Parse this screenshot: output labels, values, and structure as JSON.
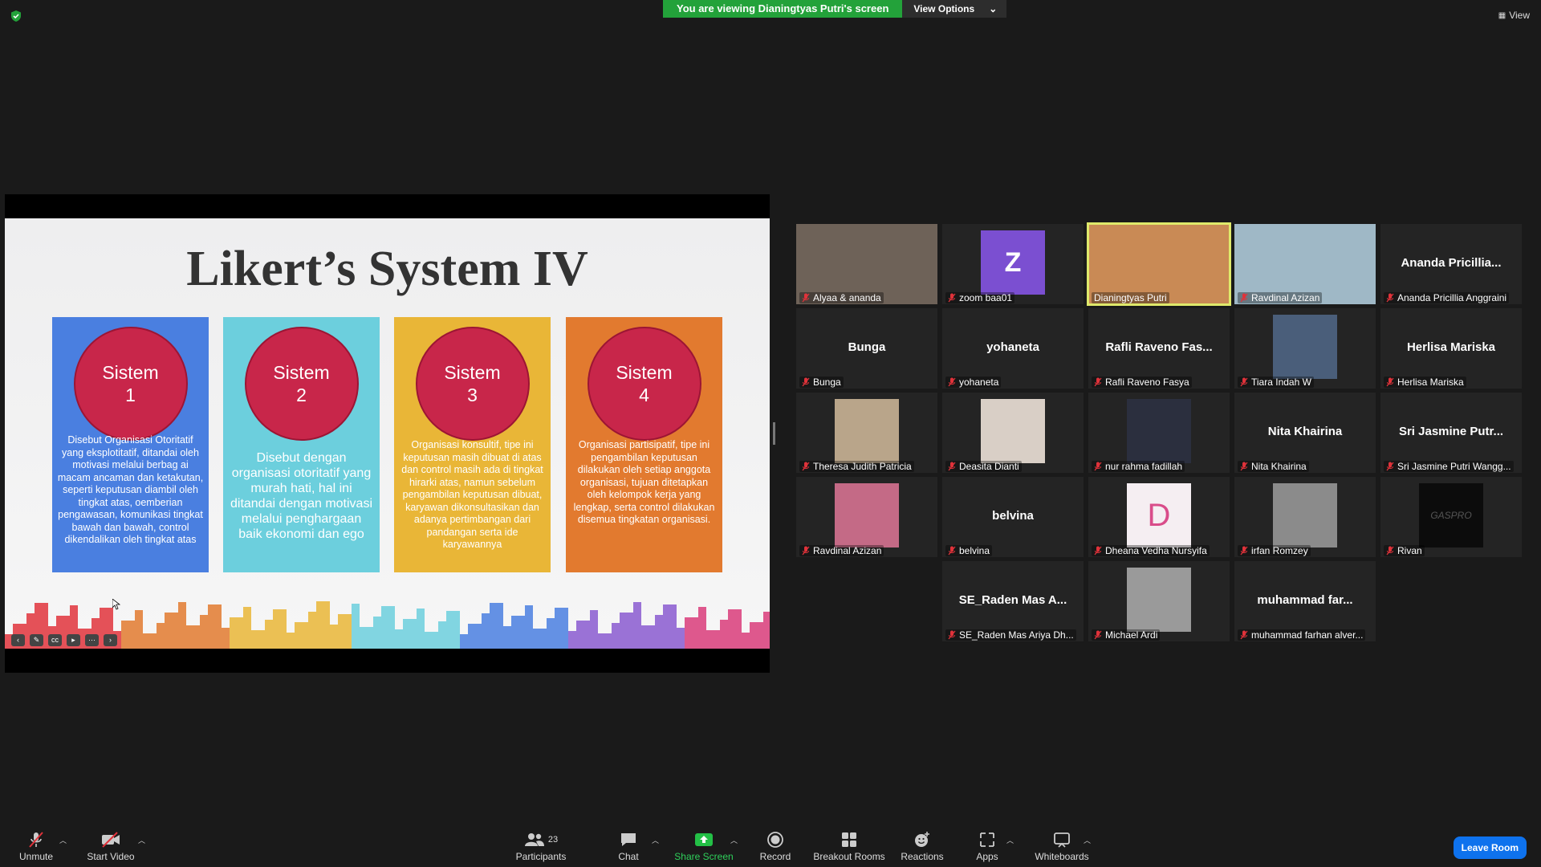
{
  "top": {
    "banner_message": "You are viewing Dianingtyas Putri's screen",
    "view_options_label": "View Options",
    "view_label": "View"
  },
  "slide": {
    "title": "Likert’s System IV",
    "cards": [
      {
        "circle": "Sistem\n1",
        "color": "#4a7fe0",
        "desc": "Disebut Organisasi Otoritatif yang eksplotitatif,   ditandai oleh motivasi melalui berbag ai macam ancaman dan ketakutan, seperti keputusan diambil oleh tingkat atas, oemberian pengawasan, komunikasi tingkat bawah dan bawah, control dikendalikan oleh tingkat atas"
      },
      {
        "circle": "Sistem\n2",
        "color": "#6ccfdd",
        "desc": "Disebut dengan organisasi otoritatif yang murah hati, hal ini ditandai dengan motivasi melalui penghargaan baik ekonomi dan ego"
      },
      {
        "circle": "Sistem\n3",
        "color": "#e9b637",
        "desc": "Organisasi konsultif, tipe ini keputusan masih dibuat di atas dan control masih ada di tingkat hirarki atas, namun sebelum pengambilan keputusan dibuat, karyawan dikonsultasikan  dan adanya pertimbangan dari pandangan serta ide karyawannya"
      },
      {
        "circle": "Sistem\n4",
        "color": "#e27a2f",
        "desc": "Organisasi partisipatif, tipe ini pengambilan keputusan dilakukan oleh setiap anggota organisasi, tujuan ditetapkan oleh kelompok kerja yang lengkap, serta control dilakukan disemua tingkatan organisasi."
      }
    ]
  },
  "participants": [
    {
      "label": "Alyaa & ananda",
      "type": "video",
      "bg": "#6e6258"
    },
    {
      "label": "zoom baa01",
      "type": "avatar",
      "letter": "Z",
      "bg": "#7b4fd1"
    },
    {
      "label": "Dianingtyas Putri",
      "type": "video",
      "bg": "#c98a55",
      "active": true
    },
    {
      "label": "Ravdinal Azizan",
      "type": "video",
      "bg": "#9fb8c6"
    },
    {
      "label": "Ananda Pricillia Anggraini",
      "type": "name",
      "big": "Ananda Pricillia..."
    },
    {
      "label": "Bunga",
      "type": "name",
      "big": "Bunga"
    },
    {
      "label": "yohaneta",
      "type": "name",
      "big": "yohaneta"
    },
    {
      "label": "Rafli Raveno Fasya",
      "type": "name",
      "big": "Rafli Raveno Fas..."
    },
    {
      "label": "Tiara Indah W",
      "type": "photo",
      "bg": "#4a5e7a"
    },
    {
      "label": "Herlisa Mariska",
      "type": "name",
      "big": "Herlisa Mariska"
    },
    {
      "label": "Theresa Judith Patricia",
      "type": "photo",
      "bg": "#b9a58a"
    },
    {
      "label": "Deasita Dianti",
      "type": "photo",
      "bg": "#d9cfc6"
    },
    {
      "label": "nur rahma fadillah",
      "type": "photo",
      "bg": "#2b2f3e"
    },
    {
      "label": "Nita Khairina",
      "type": "name",
      "big": "Nita Khairina"
    },
    {
      "label": "Sri Jasmine Putri Wangg...",
      "type": "name",
      "big": "Sri Jasmine Putr..."
    },
    {
      "label": "Ravdinal Azizan",
      "type": "photo",
      "bg": "#c46a86"
    },
    {
      "label": "belvina",
      "type": "name",
      "big": "belvina"
    },
    {
      "label": "Dheana Vedha Nursyifa",
      "type": "photo",
      "bg": "#f5eef2",
      "letter": "D"
    },
    {
      "label": "irfan Romzey",
      "type": "photo",
      "bg": "#8b8b8b"
    },
    {
      "label": "Rivan",
      "type": "photo",
      "bg": "#0c0c0c",
      "letter": "GASPRO"
    },
    {
      "label": "SE_Raden Mas Ariya Dh...",
      "type": "name",
      "big": "SE_Raden Mas A..."
    },
    {
      "label": "Michael Ardi",
      "type": "photo",
      "bg": "#9a9a9a"
    },
    {
      "label": "muhammad farhan alver...",
      "type": "name",
      "big": "muhammad far..."
    }
  ],
  "toolbar": {
    "unmute": "Unmute",
    "start_video": "Start Video",
    "participants": "Participants",
    "participants_count": "23",
    "chat": "Chat",
    "share_screen": "Share Screen",
    "record": "Record",
    "breakout_rooms": "Breakout Rooms",
    "reactions": "Reactions",
    "apps": "Apps",
    "whiteboards": "Whiteboards",
    "leave": "Leave Room"
  },
  "colors": {
    "accent_green": "#23a23a",
    "active_speaker": "#dfe96b",
    "leave_blue": "#0e72ed",
    "mic_off_red": "#e0323a"
  }
}
